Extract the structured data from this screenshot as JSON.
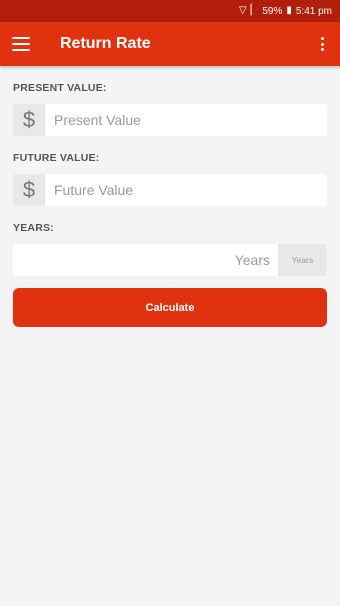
{
  "status": {
    "wifi_icon": "wifi-icon",
    "signal_icon": "signal-icon",
    "battery_pct": "59%",
    "battery_icon": "battery-icon",
    "time": "5:41 pm"
  },
  "app_bar": {
    "title": "Return Rate",
    "menu_icon": "hamburger-menu-icon",
    "overflow_icon": "more-vert-icon"
  },
  "form": {
    "present_value": {
      "label": "PRESENT VALUE:",
      "prefix": "$",
      "placeholder": "Present Value",
      "value": ""
    },
    "future_value": {
      "label": "FUTURE VALUE:",
      "prefix": "$",
      "placeholder": "Future Value",
      "value": ""
    },
    "years": {
      "label": "YEARS:",
      "placeholder": "Years",
      "suffix": "Years",
      "value": ""
    }
  },
  "calculate_label": "Calculate",
  "colors": {
    "status_bar": "#b11f0a",
    "accent": "#e0320f",
    "background": "#f4f4f4"
  }
}
